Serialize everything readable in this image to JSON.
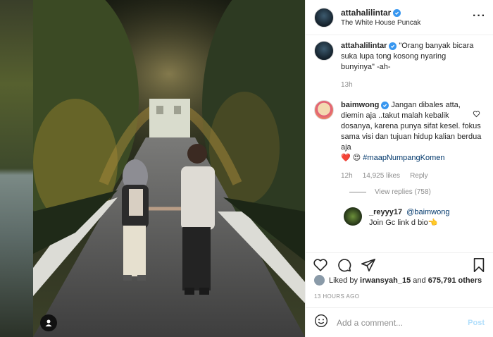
{
  "post": {
    "username": "attahalilintar",
    "location": "The White House Puncak"
  },
  "caption": {
    "username": "attahalilintar",
    "text": "\"Orang banyak bicara suka lupa tong kosong nyaring bunyinya\" -ah-",
    "time": "13h"
  },
  "comment": {
    "username": "baimwong",
    "text": "Jangan dibales atta, diemin aja ..takut malah kebalik dosanya, karena punya sifat kesel. fokus sama visi dan tujuan hidup kalian berdua aja",
    "emoji": "❤️ 😍",
    "hashtag": "#maapNumpangKomen",
    "time": "12h",
    "likes": "14,925 likes",
    "reply_label": "Reply",
    "view_replies": "View replies (758)"
  },
  "reply": {
    "username": "_reyyy17",
    "mention": "@baimwong",
    "text": "Join Gc link d bio👈"
  },
  "likes_line": {
    "prefix": "Liked by",
    "user": "irwansyah_15",
    "mid": "and",
    "count": "675,791 others"
  },
  "time_ago": "13 HOURS AGO",
  "add_comment": {
    "placeholder": "Add a comment...",
    "post_label": "Post"
  },
  "colors": {
    "verified": "#3897f0",
    "link": "#00376b",
    "post_disabled": "#b2dffc"
  }
}
